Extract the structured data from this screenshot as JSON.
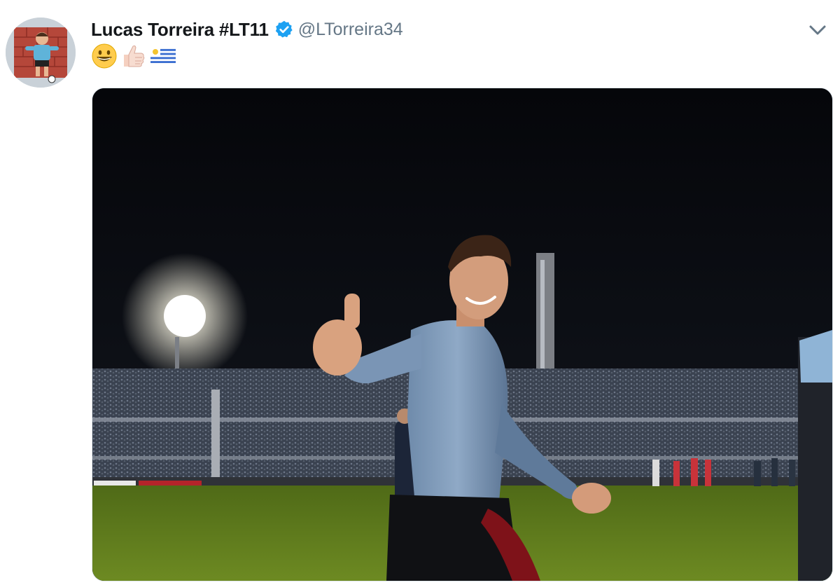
{
  "tweet": {
    "author_name": "Lucas Torreira #LT11",
    "author_handle": "@LTorreira34",
    "verified": true,
    "text_emojis": [
      "grinning-face",
      "thumbs-up",
      "flag-uruguay"
    ],
    "media_alt": "Player in light blue long-sleeve shirt giving thumbs up on a floodlit stadium pitch at night"
  },
  "colors": {
    "name_text": "#14171a",
    "handle_text": "#657786",
    "verified_badge": "#1da1f2",
    "caret": "#657786"
  }
}
